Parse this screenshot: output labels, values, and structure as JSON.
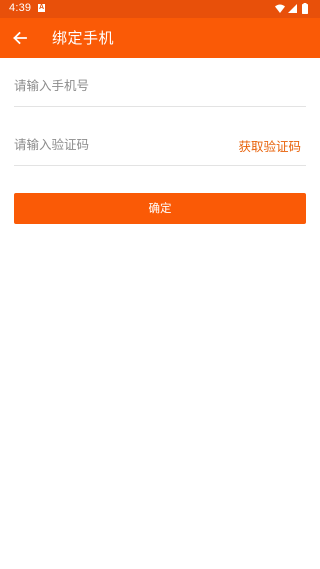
{
  "status_bar": {
    "time": "4:39",
    "notification_icon": "a-box-icon",
    "icons": [
      "wifi-icon",
      "signal-icon",
      "battery-icon"
    ]
  },
  "header": {
    "back_icon": "arrow-left-icon",
    "title": "绑定手机"
  },
  "form": {
    "phone": {
      "placeholder": "请输入手机号",
      "value": ""
    },
    "code": {
      "placeholder": "请输入验证码",
      "value": "",
      "get_code_label": "获取验证码"
    },
    "confirm_label": "确定"
  },
  "colors": {
    "status_bar": "#e8500a",
    "app_bar": "#fa5a06",
    "accent_text": "#e8620a",
    "placeholder": "#8c8c8c",
    "divider": "#e3e3e3"
  }
}
